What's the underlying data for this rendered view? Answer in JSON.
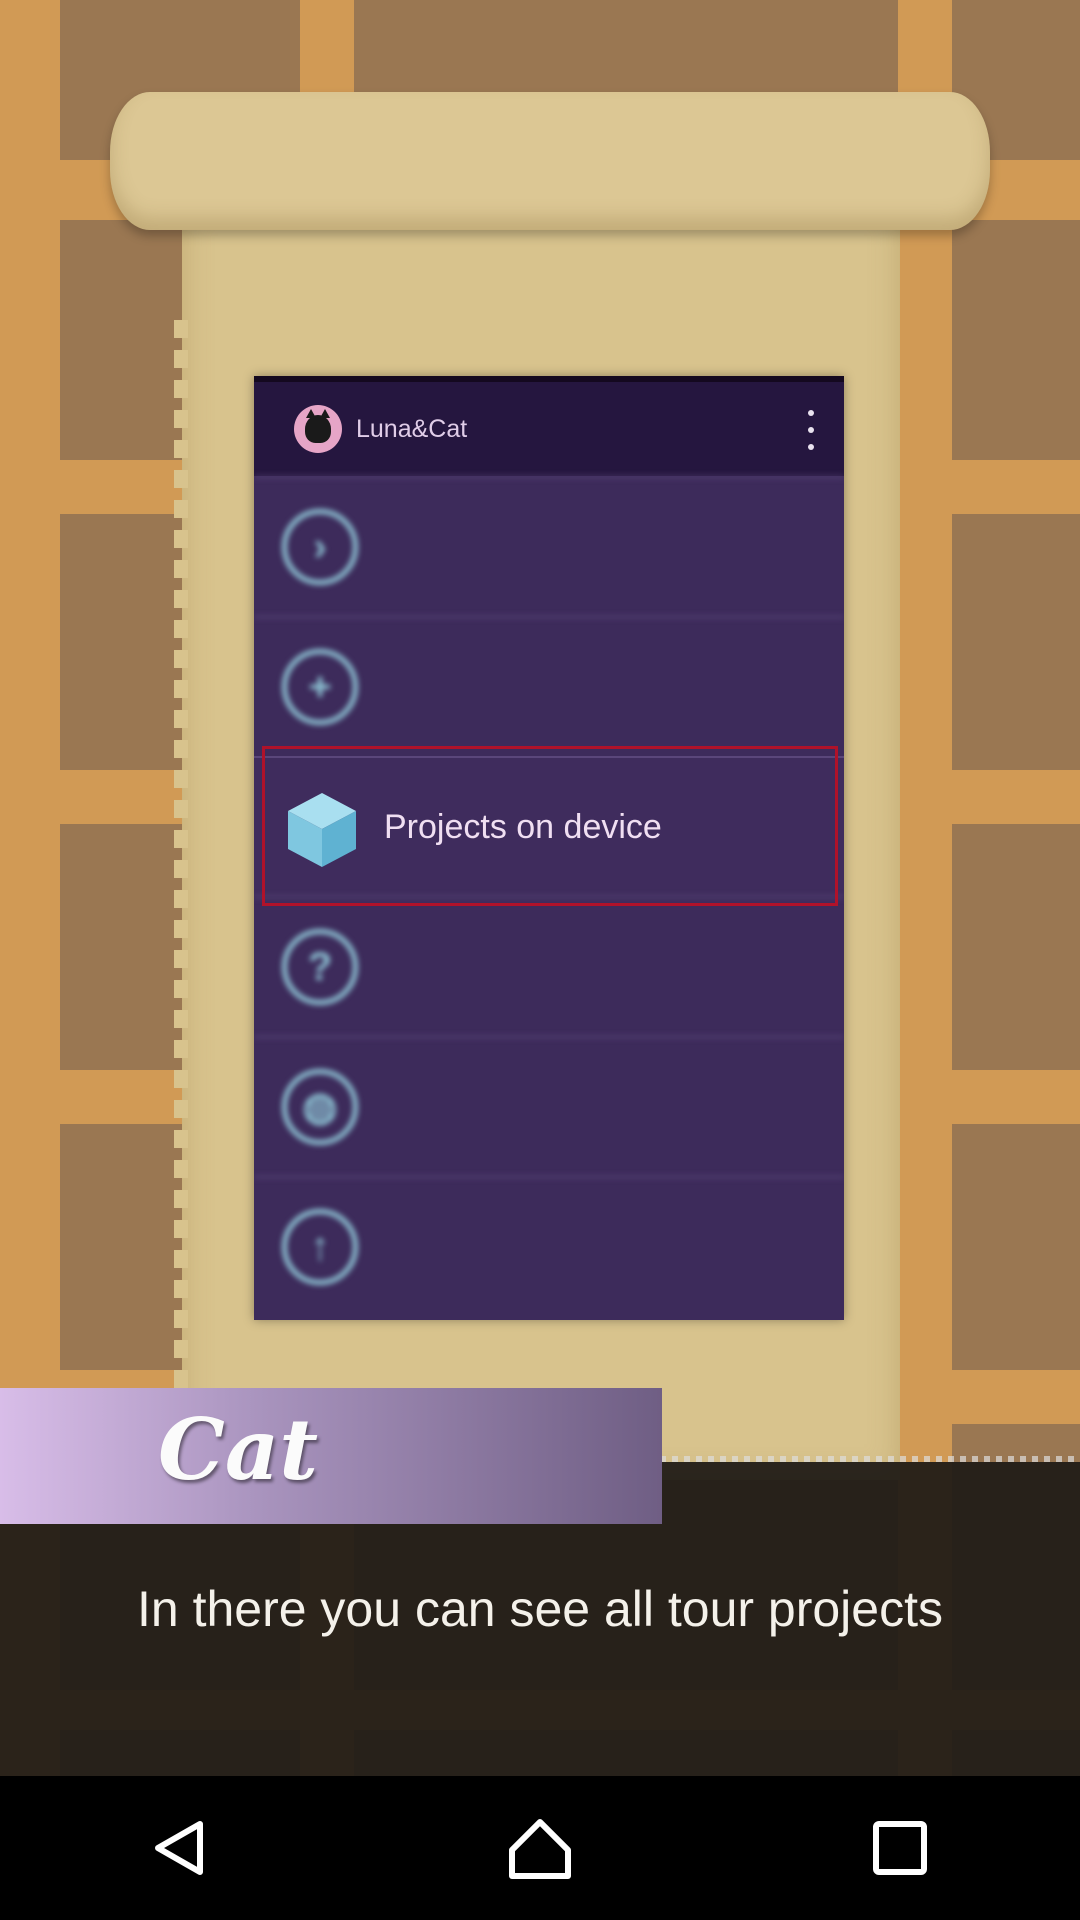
{
  "app": {
    "title": "Luna&Cat"
  },
  "menu": {
    "items": [
      {
        "icon": "chevron-right-icon",
        "label": "",
        "blurred": true
      },
      {
        "icon": "plus-icon",
        "label": "",
        "blurred": true
      },
      {
        "icon": "box-icon",
        "label": "Projects on device",
        "highlighted": true
      },
      {
        "icon": "question-icon",
        "label": "",
        "blurred": true
      },
      {
        "icon": "globe-icon",
        "label": "",
        "blurred": true
      },
      {
        "icon": "upload-icon",
        "label": "",
        "blurred": true
      }
    ]
  },
  "dialog": {
    "speaker": "Cat",
    "text": "In there you can see all tour projects"
  },
  "navigation": {
    "back": "back-icon",
    "home": "home-icon",
    "recents": "recents-icon"
  },
  "colors": {
    "highlight_frame": "#b0122a",
    "menu_bg": "#3d2b5b",
    "appbar_bg": "#25163f",
    "icon_accent": "#8fc6d6"
  }
}
